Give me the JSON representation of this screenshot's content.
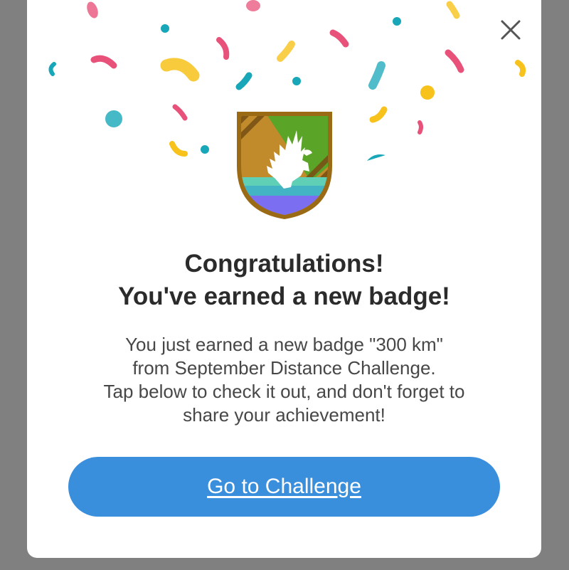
{
  "modal": {
    "close_icon": "close-icon",
    "badge_icon": "eagle-shield-badge-icon",
    "title_line1": "Congratulations!",
    "title_line2": "You've earned a new badge!",
    "description_lines": [
      "You just earned a new badge \"300 km\"",
      "from September Distance Challenge.",
      "Tap below to check it out, and don't forget to",
      "share your achievement!"
    ],
    "cta_label": "Go to Challenge"
  },
  "colors": {
    "overlay": "#808080",
    "modal_bg": "#ffffff",
    "cta_bg": "#3a8fdd",
    "cta_text": "#ffffff",
    "title_text": "#2b2b2b",
    "body_text": "#474747",
    "confetti_pink": "#e8527a",
    "confetti_yellow": "#f7c21b",
    "confetti_teal": "#17a7b8"
  }
}
